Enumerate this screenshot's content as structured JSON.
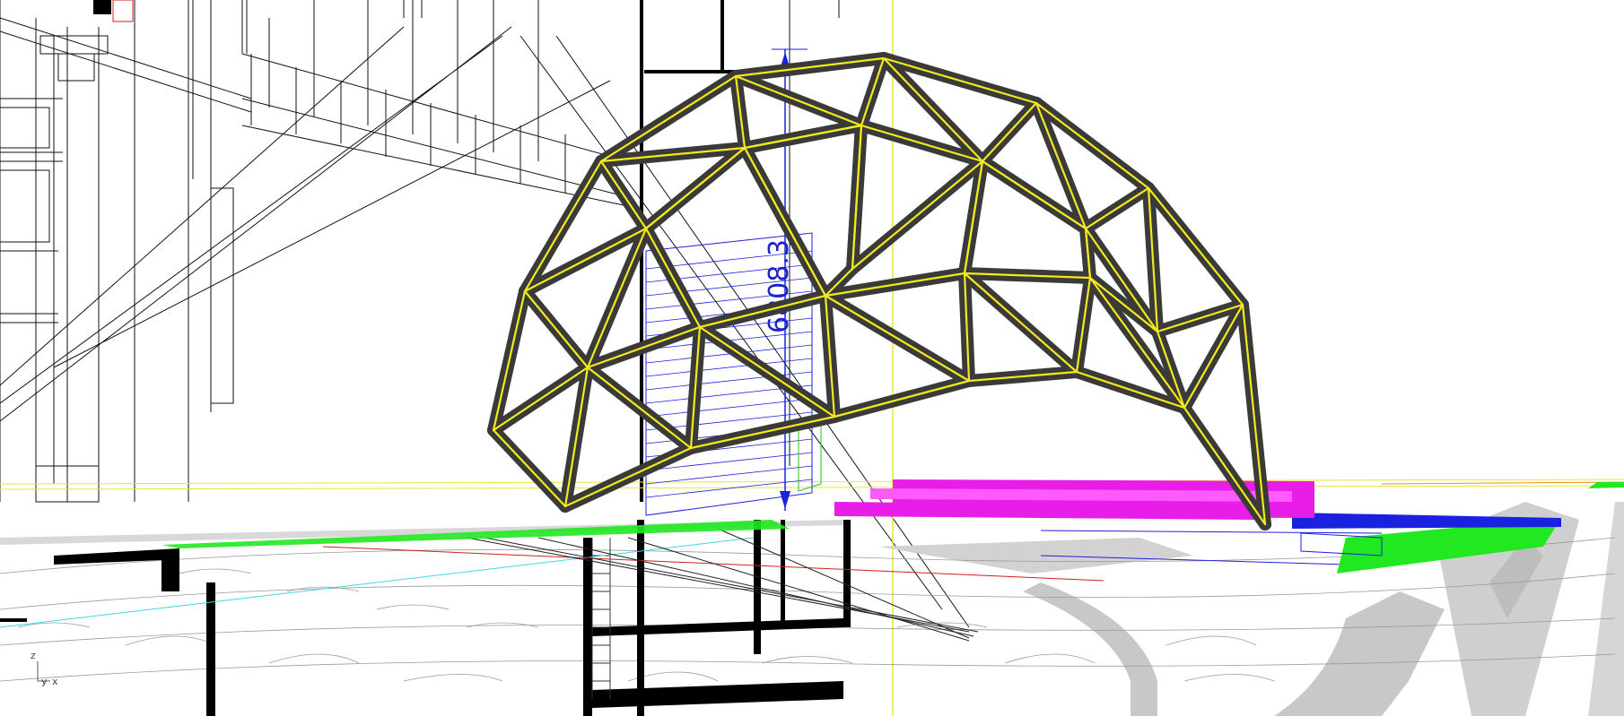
{
  "viewport": {
    "dimension_value": "6808.3",
    "axis_labels": {
      "z": "z",
      "y": "y",
      "x": "x"
    },
    "colors": {
      "background": "#ffffff",
      "structure_fill": "#3a3a38",
      "selection_highlight": "#f2ea1c",
      "dimension": "#1a22c8",
      "magenta_block": "#e81ee8",
      "green_hatch": "#22e822",
      "blue_hatch": "#1a22e0",
      "ground_gray": "#c8c8c8",
      "vertical_guide": "#e8e830"
    }
  }
}
